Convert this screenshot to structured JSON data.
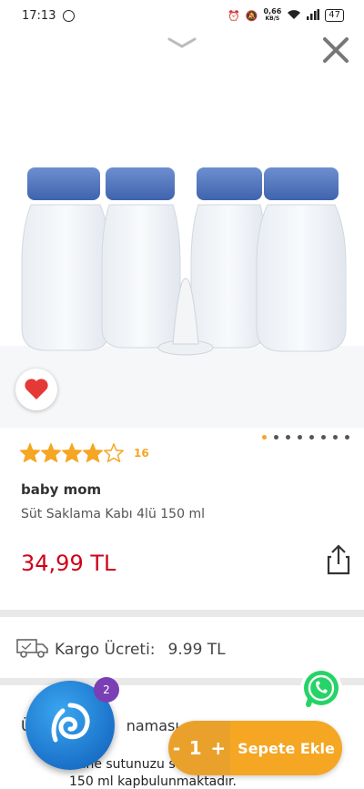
{
  "status_bar": {
    "time": "17:13",
    "net_speed_value": "0,66",
    "net_speed_unit": "KB/S",
    "battery": "47"
  },
  "product": {
    "rating": 4,
    "rating_max": 5,
    "review_count": "16",
    "brand": "baby mom",
    "name": "Süt Saklama Kabı 4lü 150 ml",
    "price": "34,99 TL",
    "image_pages": 8,
    "active_image": 1
  },
  "cargo": {
    "label": "Kargo Ücreti:",
    "value": "9.99 TL"
  },
  "description": {
    "title_start": "Ü",
    "title_end": "naması",
    "items": [
      "Anne sutunuzu sa",
      "150 ml kapbulunmaktadır."
    ]
  },
  "floating": {
    "badge_count": "2"
  },
  "cart": {
    "minus": "-",
    "quantity": "1",
    "plus": "+",
    "add_label": "Sepete Ekle"
  },
  "colors": {
    "accent": "#f5a623",
    "price": "#d0021b",
    "logo": "#1b72c9",
    "badge": "#7a3fb4",
    "whatsapp": "#25d366"
  }
}
